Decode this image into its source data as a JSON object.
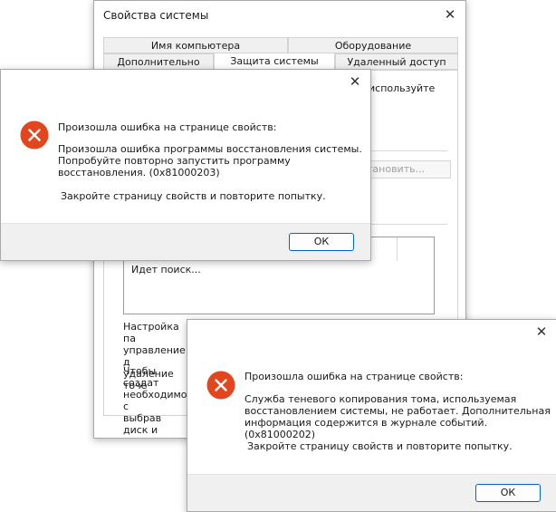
{
  "colors": {
    "error_red": "#e1461f",
    "accent_blue": "#0067c0",
    "footer_gray": "#f0f0f0"
  },
  "props": {
    "title": "Свойства системы",
    "tabs_row1": [
      "Имя компьютера",
      "Оборудование"
    ],
    "tabs_row2": [
      "Дополнительно",
      "Защита системы",
      "Удаленный доступ"
    ],
    "partial_use": "используйте",
    "configure_btn": "тановить...",
    "searching": "Идет поиск...",
    "settings_text": [
      "Настройка па",
      "управление д",
      "удаление точе"
    ],
    "create_text": [
      "Чтобы создат",
      "необходимо с",
      "выбрав диск и"
    ]
  },
  "dialog1": {
    "heading": "Произошла ошибка на странице свойств:",
    "body": [
      "Произошла ошибка программы восстановления системы.",
      "Попробуйте повторно запустить программу",
      "восстановления. (0x81000203)"
    ],
    "close_hint": "Закройте страницу свойств и повторите попытку.",
    "ok": "ОК",
    "icon": "error-icon"
  },
  "dialog2": {
    "heading": "Произошла ошибка на странице свойств:",
    "body": [
      "Служба теневого копирования тома, используемая",
      "восстановлением системы, не работает. Дополнительная",
      "информация содержится в журнале событий. (0x81000202)"
    ],
    "close_hint": "Закройте страницу свойств и повторите попытку.",
    "ok": "ОК",
    "icon": "error-icon"
  }
}
